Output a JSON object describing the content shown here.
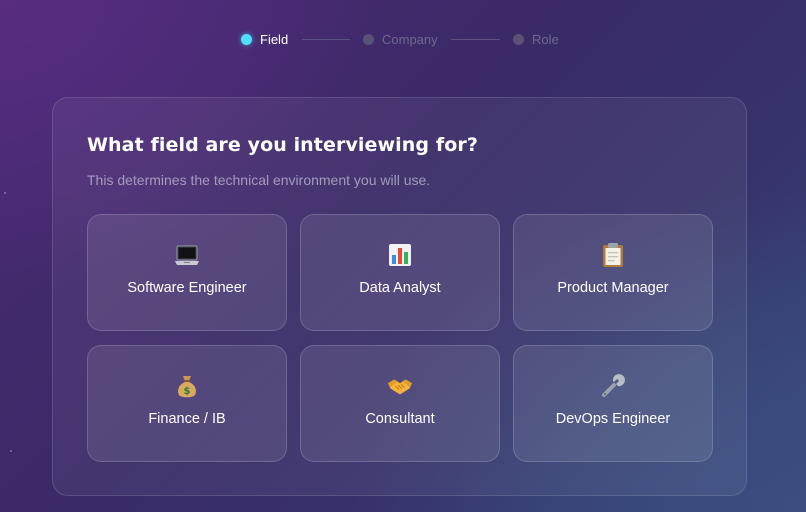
{
  "stepper": {
    "steps": [
      {
        "label": "Field",
        "state": "active"
      },
      {
        "label": "Company",
        "state": "inactive"
      },
      {
        "label": "Role",
        "state": "inactive"
      }
    ]
  },
  "question": {
    "title": "What field are you interviewing for?",
    "subtitle": "This determines the technical environment you will use."
  },
  "options": [
    {
      "label": "Software Engineer",
      "icon": "laptop-icon"
    },
    {
      "label": "Data Analyst",
      "icon": "bar-chart-icon"
    },
    {
      "label": "Product Manager",
      "icon": "clipboard-icon"
    },
    {
      "label": "Finance / IB",
      "icon": "money-bag-icon"
    },
    {
      "label": "Consultant",
      "icon": "handshake-icon"
    },
    {
      "label": "DevOps Engineer",
      "icon": "wrench-icon"
    }
  ],
  "colors": {
    "active_step": "#4ee0ff",
    "inactive_step": "#5a5275"
  }
}
